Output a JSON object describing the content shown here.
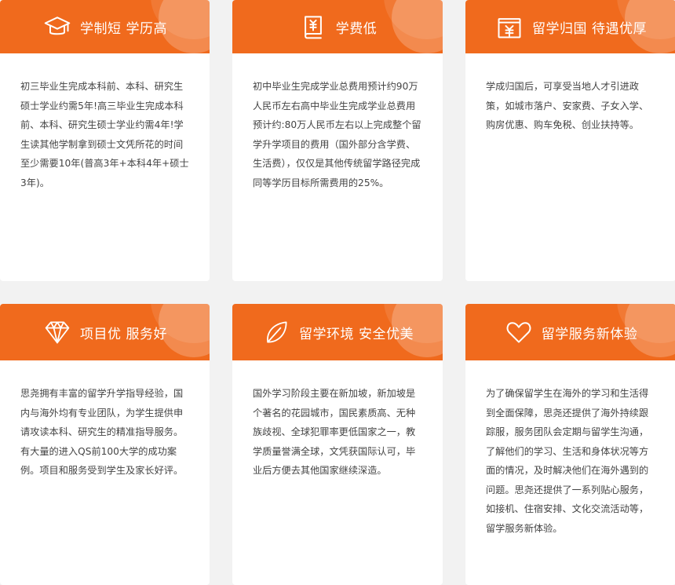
{
  "accent_color": "#f06a1d",
  "cards": [
    {
      "icon": "graduation-cap-icon",
      "title": "学制短 学历高",
      "text": "初三毕业生完成本科前、本科、研究生硕士学业约需5年!高三毕业生完成本科前、本科、研究生硕士学业约需4年!学生读其他学制拿到硕士文凭所花的时间至少需要10年(普高3年+本科4年+硕士3年)。"
    },
    {
      "icon": "tuition-book-icon",
      "title": "学费低",
      "text": "初中毕业生完成学业总费用预计约90万人民币左右高中毕业生完成学业总费用预计约:80万人民币左右以上完成整个留学升学项目的费用（国外部分含学费、生活费），仅仅是其他传统留学路径完成同等学历目标所需费用的25%。"
    },
    {
      "icon": "calendar-money-icon",
      "title": "留学归国 待遇优厚",
      "text": "学成归国后，可享受当地人才引进政策，如城市落户、安家费、子女入学、购房优惠、购车免税、创业扶持等。"
    },
    {
      "icon": "diamond-icon",
      "title": "项目优 服务好",
      "text": "思尧拥有丰富的留学升学指导经验，国内与海外均有专业团队，为学生提供申请攻读本科、研究生的精准指导服务。有大量的进入QS前100大学的成功案例。项目和服务受到学生及家长好评。"
    },
    {
      "icon": "leaf-icon",
      "title": "留学环境 安全优美",
      "text": "国外学习阶段主要在新加坡，新加坡是个著名的花园城市，国民素质高、无种族歧视、全球犯罪率更低国家之一，教学质量誉满全球，文凭获国际认可，毕业后方便去其他国家继续深造。"
    },
    {
      "icon": "heart-icon",
      "title": "留学服务新体验",
      "text": "为了确保留学生在海外的学习和生活得到全面保障，思尧还提供了海外持续跟踪服，服务团队会定期与留学生沟通，了解他们的学习、生活和身体状况等方面的情况，及时解决他们在海外遇到的问题。思尧还提供了一系列贴心服务，如接机、住宿安排、文化交流活动等，留学服务新体验。"
    }
  ]
}
